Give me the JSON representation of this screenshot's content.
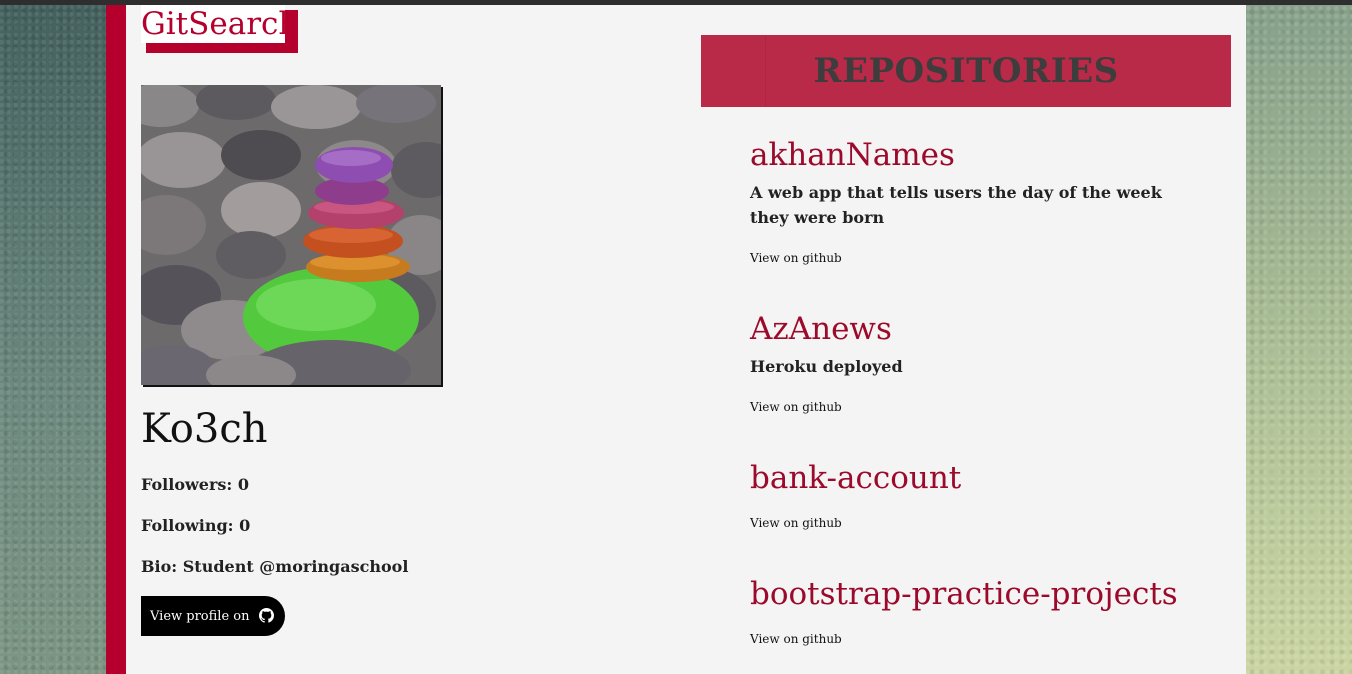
{
  "brand": {
    "title": "GitSearch"
  },
  "profile": {
    "avatar_icon": "stacked-stones-avatar",
    "username": "Ko3ch",
    "followers": "Followers: 0",
    "following": "Following: 0",
    "bio": "Bio: Student @moringaschool",
    "view_profile_label": "View profile on",
    "github_icon": "github-icon"
  },
  "repositories": {
    "heading": "REPOSITORIES",
    "items": [
      {
        "name": "akhanNames",
        "description": "A web app that tells users the day of the week they were born",
        "link_label": "View on github"
      },
      {
        "name": "AzAnews",
        "description": "Heroku deployed",
        "link_label": "View on github"
      },
      {
        "name": "bank-account",
        "description": "",
        "link_label": "View on github"
      },
      {
        "name": "bootstrap-practice-projects",
        "description": "",
        "link_label": "View on github"
      }
    ]
  },
  "colors": {
    "accent": "#b5002e",
    "header_bg": "#b82a47",
    "repo_name": "#9c0a2b",
    "panel": "#f4f4f4"
  }
}
